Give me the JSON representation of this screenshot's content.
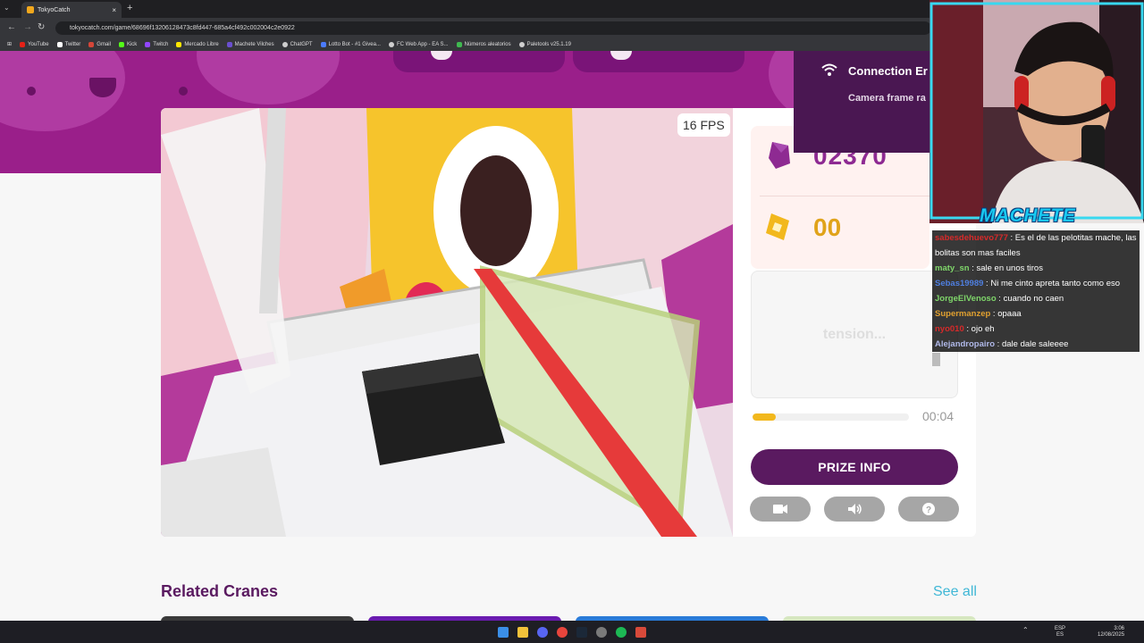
{
  "browser": {
    "tab_title": "TokyoCatch",
    "tab_close": "×",
    "new_tab": "+",
    "url": "tokyocatch.com/game/68696f13206128473c8fd447-685a4cf492c002004c2e0922",
    "bookmarks": [
      "YouTube",
      "Twitter",
      "Gmail",
      "Kick",
      "Twitch",
      "Mercado Libre",
      "Machete Vilches",
      "ChatGPT",
      "Lotto Bot - #1 Givea...",
      "FC Web App - EA S...",
      "Números aleatorios",
      "Paletools v25.1.19"
    ]
  },
  "game": {
    "fps": "16 FPS",
    "coins": "02370",
    "tickets": "00",
    "tension": "tension...",
    "timer": "00:04",
    "progress": 0.15,
    "prize_button": "PRIZE INFO"
  },
  "toast": {
    "title": "Connection Er",
    "message": "Camera frame ra"
  },
  "related": {
    "title": "Related Cranes",
    "see_all": "See all"
  },
  "overlay": {
    "streamer_name": "MACHETE",
    "chat": [
      {
        "user": "sabesdehuevo777",
        "text": "Es el de las pelotitas mache, las bolitas son mas faciles",
        "color": "#d62a2a"
      },
      {
        "user": "maty_sn",
        "text": "sale en unos tiros",
        "color": "#7fd66a"
      },
      {
        "user": "Sebas19989",
        "text": "Ni me cinto apreta tanto como eso",
        "color": "#4f7fe0"
      },
      {
        "user": "JorgeElVenoso",
        "text": "cuando no caen",
        "color": "#7fd66a"
      },
      {
        "user": "Supermanzep",
        "text": "opaaa",
        "color": "#e0a030"
      },
      {
        "user": "nyo010",
        "text": "ojo eh",
        "color": "#d62a2a"
      },
      {
        "user": "Alejandropairo",
        "text": "dale dale saleeee",
        "color": "#b0b8e8"
      }
    ]
  },
  "taskbar": {
    "lang_1": "ESP",
    "lang_2": "ES",
    "time": "3:06",
    "date": "12/08/2025"
  },
  "colors": {
    "brand_purple": "#5a1a60",
    "banner": "#9a1f8a",
    "coin_text": "#8e2a92",
    "ticket_text": "#e0a31a",
    "link": "#3fb7d6"
  }
}
